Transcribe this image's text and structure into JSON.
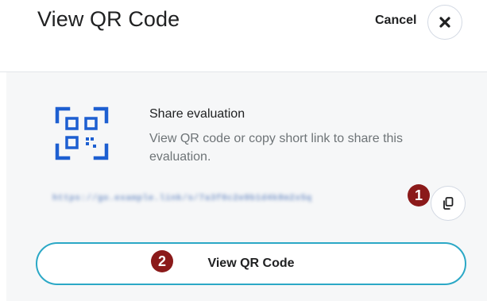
{
  "dialog": {
    "title": "View QR Code",
    "cancel_label": "Cancel",
    "close_icon": "close-icon"
  },
  "share": {
    "icon": "qr-code-icon",
    "title": "Share evaluation",
    "description": "View QR code or copy short link to share this evaluation.",
    "link": "https://go.example.link/s/7a3f0c2e9b1d4k8m2x5q",
    "copy_icon": "copy-icon"
  },
  "actions": {
    "view_qr_label": "View QR Code"
  },
  "callouts": {
    "badge_1": "1",
    "badge_2": "2"
  },
  "colors": {
    "accent": "#2ba8c6",
    "icon_blue": "#1d5fd1",
    "callout": "#8b1a1a",
    "panel_bg": "#f6f7f8"
  }
}
